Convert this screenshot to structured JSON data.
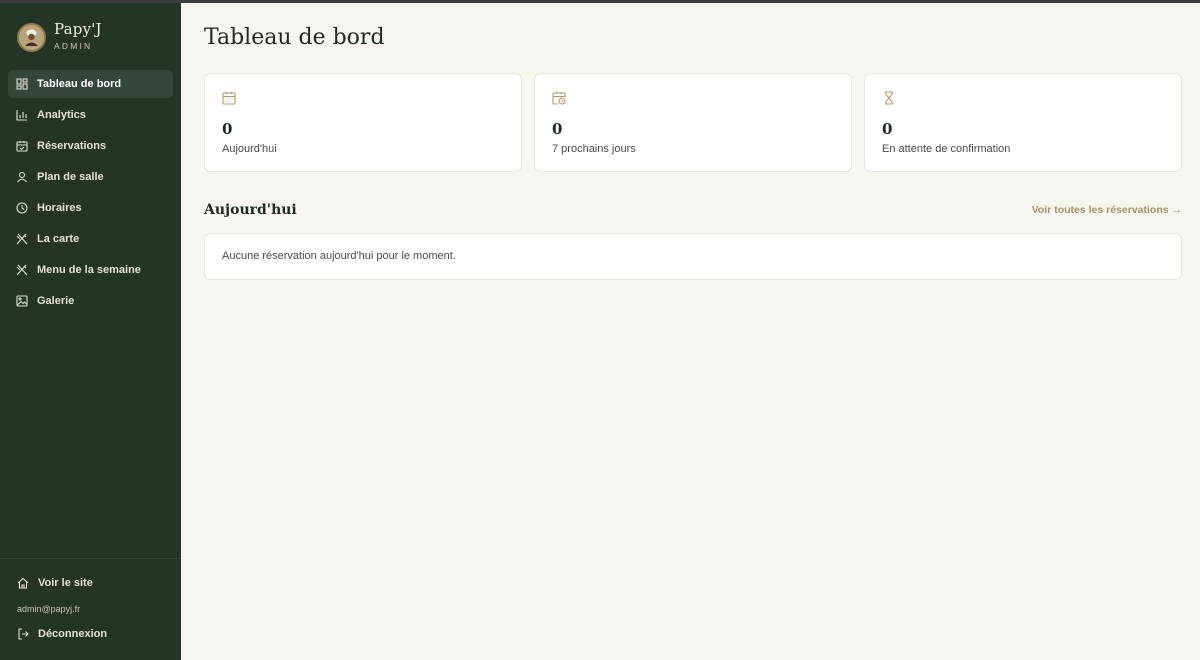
{
  "brand": {
    "name": "Papy'J",
    "role": "ADMIN"
  },
  "sidebar": {
    "items": [
      {
        "label": "Tableau de bord",
        "icon": "dashboard-icon",
        "active": true
      },
      {
        "label": "Analytics",
        "icon": "bar-chart-icon"
      },
      {
        "label": "Réservations",
        "icon": "calendar-check-icon"
      },
      {
        "label": "Plan de salle",
        "icon": "user-icon"
      },
      {
        "label": "Horaires",
        "icon": "clock-icon"
      },
      {
        "label": "La carte",
        "icon": "utensils-icon"
      },
      {
        "label": "Menu de la semaine",
        "icon": "utensils-icon"
      },
      {
        "label": "Galerie",
        "icon": "image-icon"
      }
    ],
    "view_site": "Voir le site",
    "email": "admin@papyj.fr",
    "logout": "Déconnexion"
  },
  "main": {
    "title": "Tableau de bord",
    "stats": [
      {
        "value": "0",
        "label": "Aujourd'hui",
        "icon": "calendar-icon"
      },
      {
        "value": "0",
        "label": "7 prochains jours",
        "icon": "calendar-clock-icon"
      },
      {
        "value": "0",
        "label": "En attente de confirmation",
        "icon": "hourglass-icon"
      }
    ],
    "today_section": {
      "title": "Aujourd'hui",
      "see_all": "Voir toutes les réservations →",
      "empty": "Aucune réservation aujourd'hui pour le moment."
    }
  },
  "colors": {
    "sidebar_bg": "#243528",
    "active_item_bg": "#34473a",
    "page_bg": "#f7f5ef",
    "accent": "#a8916a",
    "icon_gold": "#b89a66"
  }
}
